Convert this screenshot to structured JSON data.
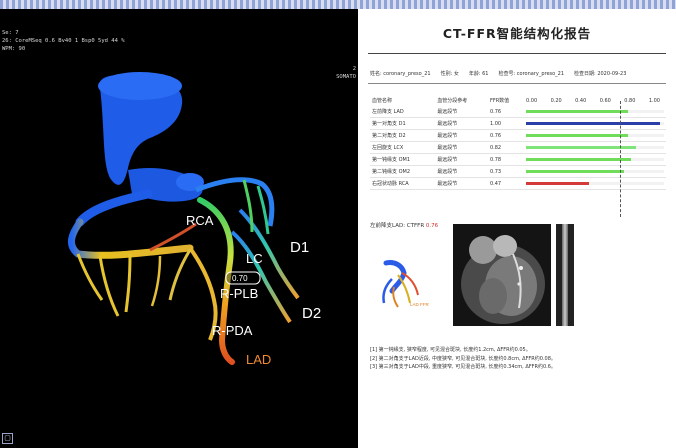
{
  "viewer": {
    "info_lines": [
      "Se: 7",
      "26: CoreMSeq 0.6 Bv40 1 Bsp0 5yd 44 %",
      "WPM: 90"
    ],
    "info_right": [
      "2",
      "SOMATO"
    ],
    "labels": {
      "rca": "RCA",
      "lc": "LC",
      "d1": "D1",
      "d2": "D2",
      "r_plb": "R-PLB",
      "r_pda": "R-PDA",
      "lad": "LAD",
      "ffr_value": "0.70"
    },
    "corner_icon": "square-icon"
  },
  "report": {
    "title": "CT-FFR智能结构化报告",
    "meta": [
      "姓名: coronary_preso_21",
      "性别: 女",
      "年龄: 61",
      "检查号: coronary_preso_21",
      "检查日期: 2020-09-23"
    ],
    "table": {
      "headers": [
        "血管名称",
        "血管分段参考",
        "FFR数值"
      ],
      "scale": [
        "0.00",
        "0.20",
        "0.40",
        "0.60",
        "0.80",
        "1.00"
      ],
      "threshold": 0.8,
      "rows": [
        {
          "name": "左前降支 LAD",
          "seg": "最远段节",
          "value": "0.76",
          "ffr": 0.76,
          "color": "#6fdc5a"
        },
        {
          "name": "第一对角支 D1",
          "seg": "最远段节",
          "value": "1.00",
          "ffr": 1.0,
          "color": "#2a3fa8"
        },
        {
          "name": "第二对角支 D2",
          "seg": "最远段节",
          "value": "0.76",
          "ffr": 0.76,
          "color": "#6fdc5a"
        },
        {
          "name": "左回旋支 LCX",
          "seg": "最远段节",
          "value": "0.82",
          "ffr": 0.82,
          "color": "#7fe47a"
        },
        {
          "name": "第一钝缘支 OM1",
          "seg": "最远段节",
          "value": "0.78",
          "ffr": 0.78,
          "color": "#6fdc5a"
        },
        {
          "name": "第二钝缘支 OM2",
          "seg": "最远段节",
          "value": "0.73",
          "ffr": 0.73,
          "color": "#6fdc5a"
        },
        {
          "name": "右冠状动脉 RCA",
          "seg": "最远段节",
          "value": "0.47",
          "ffr": 0.47,
          "color": "#d33a3a"
        }
      ]
    },
    "vessel_label": "左前降支LAD: CTFFR",
    "vessel_value": "0.76",
    "thumb_label": "LAD FFR",
    "notes": [
      "[1] 第一钝缘支, 狭窄程度, 可见混合斑块, 长度约1.2cm, ΔFFR约0.05。",
      "[2] 第二对角支于LAD近段, 中度狭窄, 可见混合斑块, 长度约0.8cm, ΔFFR约0.08。",
      "[3] 第三对角支于LAD中段, 重度狭窄, 可见混合斑块, 长度约0.34cm, ΔFFR约0.6。"
    ]
  }
}
